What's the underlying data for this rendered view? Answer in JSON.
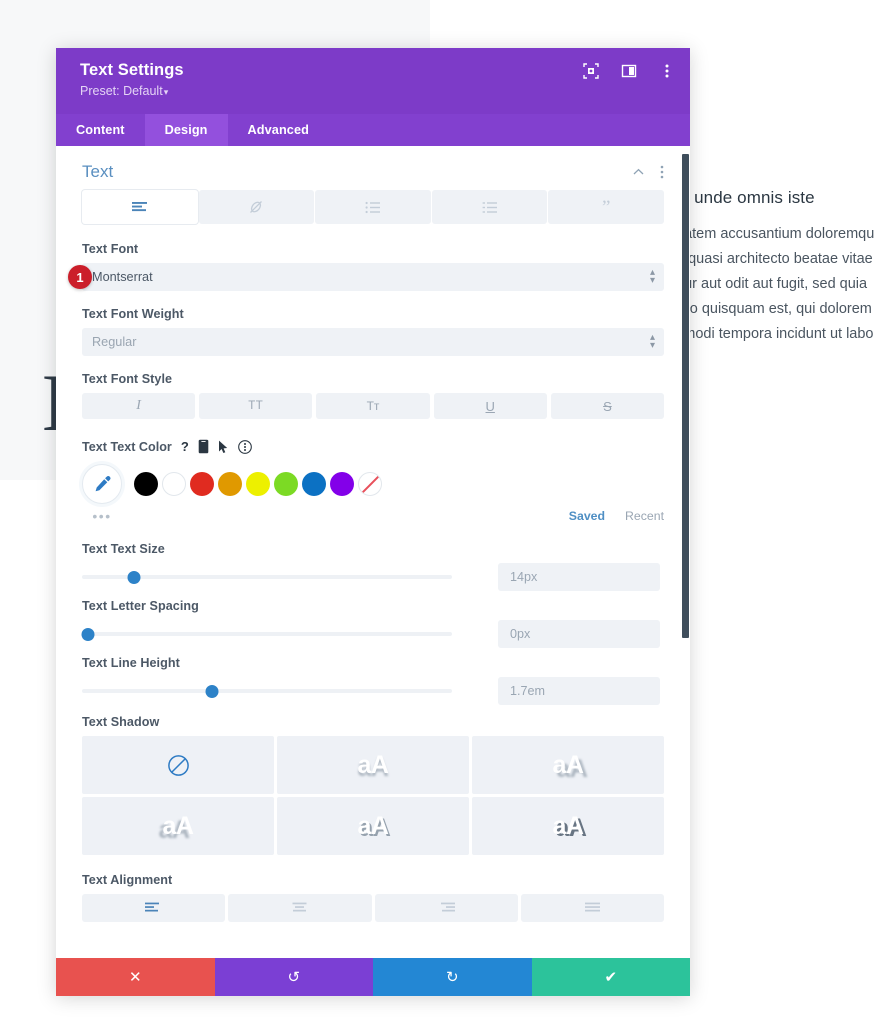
{
  "background": {
    "letter": "E",
    "article": {
      "heading": "tis unde omnis iste",
      "lines": [
        "ptatem accusantium doloremqu",
        "et quasi architecto beatae vitae",
        "atur aut odit aut fugit, sed quia",
        "orro quisquam est, qui dolorem",
        "s modi tempora incidunt ut labo"
      ]
    }
  },
  "modal": {
    "title": "Text Settings",
    "preset_label": "Preset: Default",
    "header_icons": [
      {
        "name": "focus-icon",
        "glyph": "focus"
      },
      {
        "name": "layout-panel-icon",
        "glyph": "panel"
      },
      {
        "name": "more-options-icon",
        "glyph": "dots"
      }
    ],
    "tabs": [
      {
        "label": "Content",
        "active": false
      },
      {
        "label": "Design",
        "active": true
      },
      {
        "label": "Advanced",
        "active": false
      }
    ]
  },
  "section": {
    "title": "Text",
    "collapse_icon": "chevron-up-icon",
    "options_icon": "vertical-dots-icon"
  },
  "text_type_toggles": [
    {
      "name": "paragraph",
      "icon": "paragraph-align-icon",
      "active": true
    },
    {
      "name": "link",
      "icon": "link-slash-icon",
      "active": false
    },
    {
      "name": "unordered-list",
      "icon": "bullet-list-icon",
      "active": false
    },
    {
      "name": "ordered-list",
      "icon": "numbered-list-icon",
      "active": false
    },
    {
      "name": "quote",
      "icon": "quote-icon",
      "active": false
    }
  ],
  "fields": {
    "font": {
      "label": "Text Font",
      "value": "Montserrat",
      "badge": "1"
    },
    "font_weight": {
      "label": "Text Font Weight",
      "value": "Regular"
    },
    "font_style": {
      "label": "Text Font Style",
      "buttons": [
        {
          "name": "italic",
          "glyph": "I"
        },
        {
          "name": "uppercase",
          "glyph": "TT"
        },
        {
          "name": "small-caps",
          "glyph": "Tт"
        },
        {
          "name": "underline",
          "glyph": "U"
        },
        {
          "name": "strikethrough",
          "glyph": "S"
        }
      ]
    },
    "text_color": {
      "label": "Text Text Color",
      "icons": [
        {
          "name": "help-icon",
          "glyph": "?"
        },
        {
          "name": "responsive-mobile-icon",
          "glyph": "mobile"
        },
        {
          "name": "hover-cursor-icon",
          "glyph": "cursor"
        },
        {
          "name": "color-options-icon",
          "glyph": "dots"
        }
      ],
      "eyedropper": "eyedropper-icon",
      "swatches": [
        {
          "name": "black",
          "hex": "#000000"
        },
        {
          "name": "white",
          "hex": "#FFFFFF"
        },
        {
          "name": "red",
          "hex": "#E02B20"
        },
        {
          "name": "orange",
          "hex": "#E09900"
        },
        {
          "name": "yellow",
          "hex": "#EDF000"
        },
        {
          "name": "green",
          "hex": "#7CDA24"
        },
        {
          "name": "blue",
          "hex": "#0C71C3"
        },
        {
          "name": "purple",
          "hex": "#8300E9"
        },
        {
          "name": "transparent",
          "hex": "none"
        }
      ],
      "more_label": "•••",
      "saved_label": "Saved",
      "recent_label": "Recent"
    },
    "text_size": {
      "label": "Text Text Size",
      "value": "14px",
      "percent": 14
    },
    "letter_spacing": {
      "label": "Text Letter Spacing",
      "value": "0px",
      "percent": 1
    },
    "line_height": {
      "label": "Text Line Height",
      "value": "1.7em",
      "percent": 35
    },
    "text_shadow": {
      "label": "Text Shadow",
      "presets": [
        {
          "name": "none",
          "glyph": "none",
          "active": true
        },
        {
          "name": "shadow-down",
          "glyph": "aA",
          "active": false
        },
        {
          "name": "shadow-down-right",
          "glyph": "aA",
          "active": false
        },
        {
          "name": "shadow-down-left",
          "glyph": "aA",
          "active": false
        },
        {
          "name": "shadow-hard",
          "glyph": "aA",
          "active": false
        },
        {
          "name": "shadow-hard-dark",
          "glyph": "aA",
          "active": false
        }
      ]
    },
    "text_alignment": {
      "label": "Text Alignment",
      "buttons": [
        {
          "name": "align-left",
          "active": true
        },
        {
          "name": "align-center",
          "active": false
        },
        {
          "name": "align-right",
          "active": false
        },
        {
          "name": "align-justify",
          "active": false
        }
      ]
    }
  },
  "footer": {
    "buttons": [
      {
        "name": "cancel",
        "glyph": "✕",
        "color": "#e8524f"
      },
      {
        "name": "undo",
        "glyph": "↺",
        "color": "#7b3fd4"
      },
      {
        "name": "redo",
        "glyph": "↻",
        "color": "#2387d4"
      },
      {
        "name": "save",
        "glyph": "✔",
        "color": "#2cc39b"
      }
    ]
  }
}
